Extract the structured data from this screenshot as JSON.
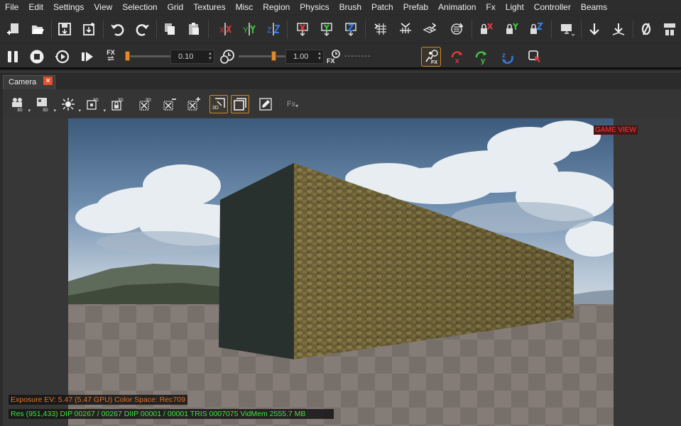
{
  "menu": [
    "File",
    "Edit",
    "Settings",
    "View",
    "Selection",
    "Grid",
    "Textures",
    "Misc",
    "Region",
    "Physics",
    "Brush",
    "Patch",
    "Prefab",
    "Animation",
    "Fx",
    "Light",
    "Controller",
    "Beams"
  ],
  "playback": {
    "speed_value": "0.10",
    "time_scale_value": "1.00",
    "timecode": "--------",
    "fx_label": "FX"
  },
  "panel": {
    "tab_title": "Camera",
    "tab_close": "×",
    "fx_menu_label": "Fx"
  },
  "viewport": {
    "game_view_label": "GAME VIEW",
    "exposure_text": "Exposure EV: 5.47 (5.47 GPU)  Color Space: Rec709",
    "stats_text": "Res (951,433)   DIP 00267 / 00267  DIIP 00001 / 00001  TRIS 0007075  VidMem 2555.7 MB"
  },
  "colors": {
    "accent_orange": "#d28b26",
    "axis_x": "#e03a3a",
    "axis_y": "#3ec83e",
    "axis_z": "#3a7ae0",
    "stats_green": "#3ee83e",
    "exposure_orange": "#e0762e",
    "game_view_red": "#ff3a3a"
  }
}
